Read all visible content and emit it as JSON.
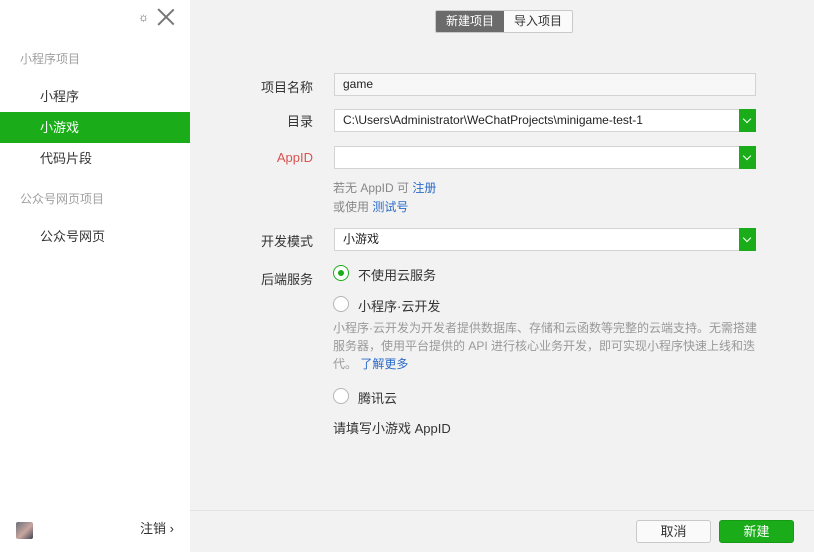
{
  "sidebar": {
    "section1_title": "小程序项目",
    "items": [
      {
        "label": "小程序"
      },
      {
        "label": "小游戏"
      },
      {
        "label": "代码片段"
      }
    ],
    "section2_title": "公众号网页项目",
    "items2": [
      {
        "label": "公众号网页"
      }
    ],
    "logout_label": "注销 ›",
    "active_item": "小游戏"
  },
  "header": {
    "tabs": [
      {
        "label": "新建项目"
      },
      {
        "label": "导入项目"
      }
    ],
    "active_tab": "新建项目"
  },
  "form": {
    "project_name_label": "项目名称",
    "project_name_value": "game",
    "directory_label": "目录",
    "directory_value": "C:\\Users\\Administrator\\WeChatProjects\\minigame-test-1",
    "appid_label": "AppID",
    "appid_value": "",
    "hint_no_appid": "若无 AppID 可",
    "hint_register_link": "注册",
    "hint_or_use": "或使用",
    "hint_test_link": "测试号",
    "dev_mode_label": "开发模式",
    "dev_mode_value": "小游戏",
    "backend_label": "后端服务",
    "backend_options": [
      {
        "label": "不使用云服务",
        "checked": true
      },
      {
        "label": "小程序·云开发",
        "checked": false
      },
      {
        "label": "腾讯云",
        "checked": false
      }
    ],
    "cloud_desc": "小程序·云开发为开发者提供数据库、存储和云函数等完整的云端支持。无需搭建服务器，使用平台提供的 API 进行核心业务开发，即可实现小程序快速上线和迭代。",
    "cloud_learn_more": "了解更多",
    "appid_required_note": "请填写小游戏 AppID"
  },
  "footer": {
    "cancel_label": "取消",
    "create_label": "新建"
  },
  "colors": {
    "accent": "#1aad19",
    "link": "#2b6bc9",
    "appid_label": "#d9534f"
  },
  "icons": [
    "gear-icon",
    "close-icon",
    "user-avatar",
    "chevron-down-icon",
    "radio-icon"
  ]
}
